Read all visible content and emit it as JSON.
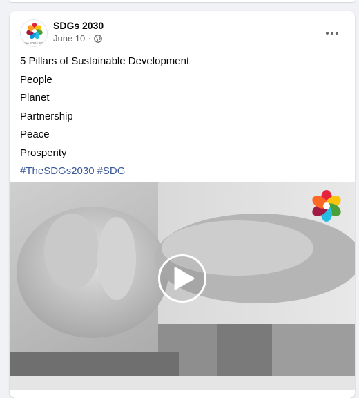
{
  "post": {
    "page_name": "SDGs 2030",
    "date": "June 10",
    "separator": "·",
    "privacy_icon": "globe-icon",
    "more_icon": "more-horizontal-icon",
    "lines": [
      "5 Pillars of Sustainable Development",
      "People",
      "Planet",
      "Partnership",
      "Peace",
      "Prosperity"
    ],
    "hashtags": [
      "#TheSDGs2030",
      "#SDG"
    ]
  },
  "avatar": {
    "logo_text": "The SDGs 2030"
  },
  "video": {
    "play_icon": "play-icon",
    "logo_icon": "sdg-flower-logo-icon"
  },
  "colors": {
    "link": "#385898",
    "secondary_text": "#65676b",
    "background": "#f0f2f5"
  }
}
